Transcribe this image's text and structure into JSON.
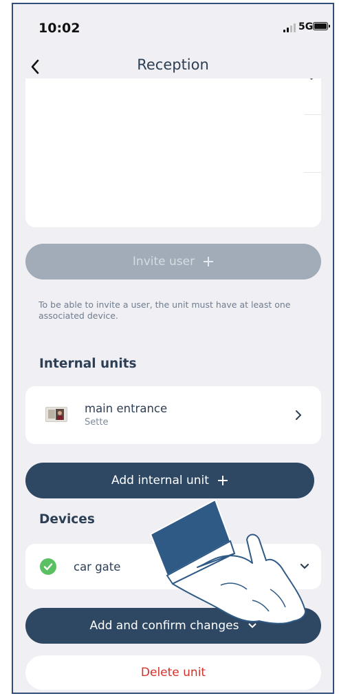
{
  "status_bar": {
    "time": "10:02",
    "network": "5G"
  },
  "nav": {
    "title": "Reception",
    "back_icon": "chevron-left-icon"
  },
  "invite": {
    "label": "Invite user",
    "icon": "plus-icon"
  },
  "invite_note": "To be able to invite a user, the unit must have at least one associated device.",
  "internal_units": {
    "title": "Internal units",
    "items": [
      {
        "name": "main entrance",
        "model": "Sette"
      }
    ],
    "add_label": "Add internal unit"
  },
  "devices": {
    "title": "Devices",
    "items": [
      {
        "name": "car gate",
        "status_icon": "check-circle-icon"
      }
    ]
  },
  "actions": {
    "confirm_label": "Add and confirm changes",
    "delete_label": "Delete unit"
  },
  "colors": {
    "primary": "#2e4863",
    "disabled": "#a2acb8",
    "danger": "#d4312b",
    "success": "#5bc064",
    "background": "#f0eff4"
  }
}
